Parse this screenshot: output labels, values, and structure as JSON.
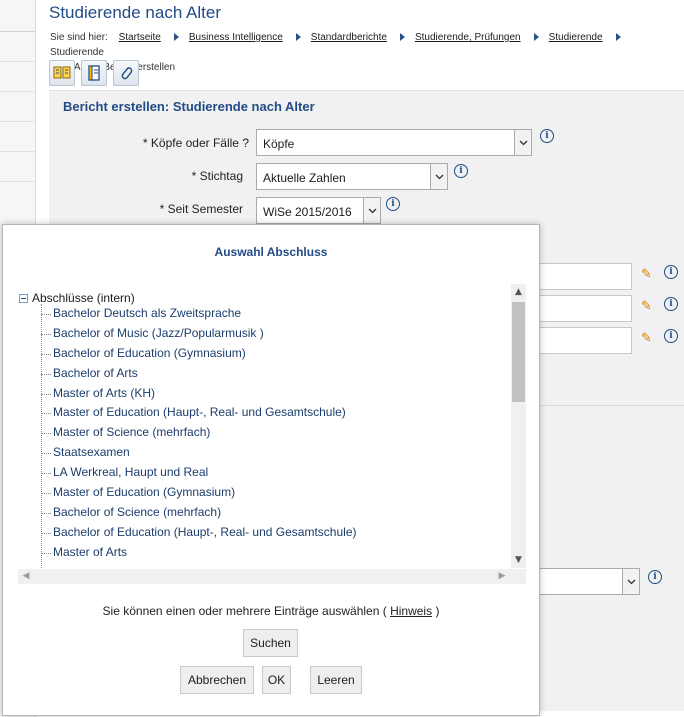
{
  "page": {
    "title": "Studierende nach Alter",
    "breadcrumb": {
      "prefix": "Sie sind hier:",
      "items": [
        "Startseite",
        "Business Intelligence",
        "Standardberichte",
        "Studierende, Prüfungen",
        "Studierende",
        "Studierende"
      ],
      "trail": "nach Alter - Bericht erstellen"
    }
  },
  "toolbar": {
    "icons": [
      "bookmark-icon",
      "notebook-icon",
      "paperclip-icon"
    ]
  },
  "form": {
    "title": "Bericht erstellen: Studierende nach Alter",
    "fields": [
      {
        "label": "* Köpfe oder Fälle ?",
        "value": "Köpfe"
      },
      {
        "label": "* Stichtag",
        "value": "Aktuelle Zahlen"
      },
      {
        "label": "* Seit Semester",
        "value": "WiSe 2015/2016"
      }
    ]
  },
  "dialog": {
    "title": "Auswahl Abschluss",
    "tree": {
      "root": "Abschlüsse (intern)",
      "items": [
        "Bachelor Deutsch als Zweitsprache",
        "Bachelor of Music (Jazz/Popularmusik )",
        "Bachelor of Education (Gymnasium)",
        "Bachelor of Arts",
        "Master of Arts (KH)",
        "Master of Education (Haupt-, Real- und Gesamtschule)",
        "Master of Science (mehrfach)",
        "Staatsexamen",
        "LA Werkreal, Haupt und Real",
        "Master of Education (Gymnasium)",
        "Bachelor of Science (mehrfach)",
        "Bachelor of Education (Haupt-, Real- und Gesamtschule)",
        "Master of Arts"
      ]
    },
    "hint": {
      "text": "Sie können einen oder mehrere Einträge auswählen (",
      "link": "Hinweis",
      "close": ")"
    },
    "buttons": {
      "search": "Suchen",
      "cancel": "Abbrechen",
      "ok": "OK",
      "clear": "Leeren"
    }
  },
  "colors": {
    "accent": "#234c86",
    "pencil": "#e07b00"
  }
}
